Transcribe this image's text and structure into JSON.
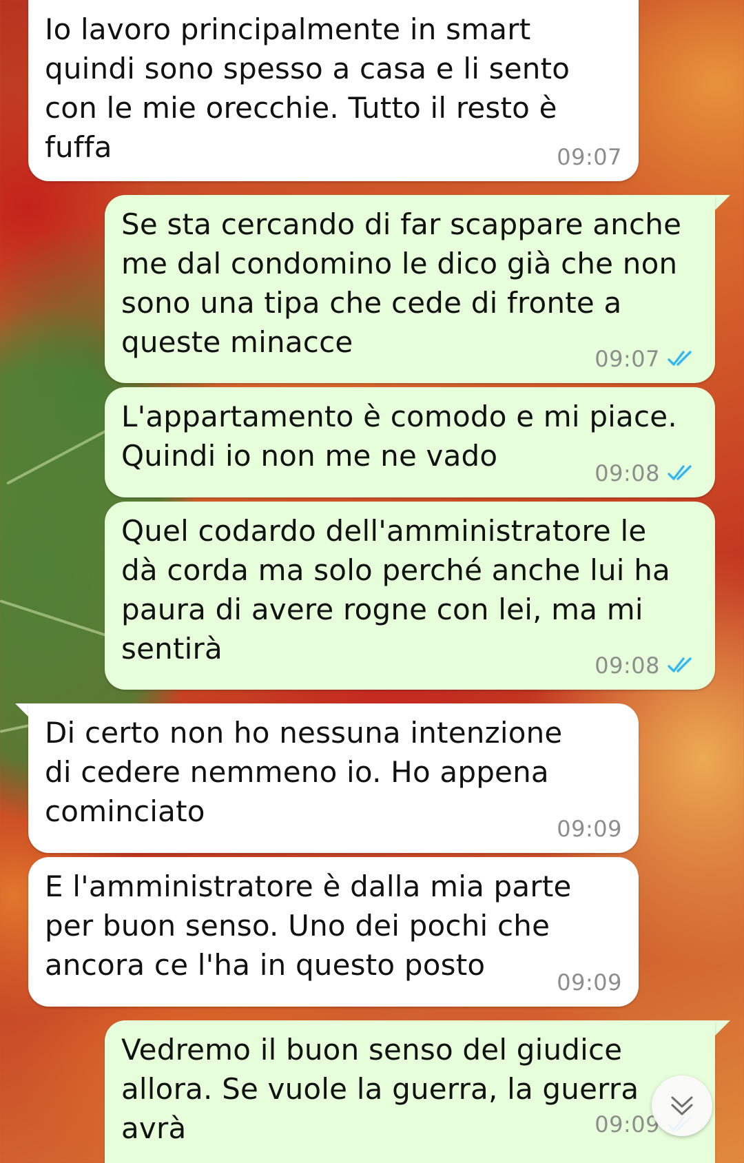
{
  "messages": [
    {
      "direction": "incoming",
      "text": "Io lavoro principalmente in smart\nquindi sono spesso a casa e li sento\ncon le mie orecchie. Tutto il resto è\nfuffa",
      "time": "09:07"
    },
    {
      "direction": "outgoing",
      "text": "Se sta cercando di far scappare anche\nme dal condomino le dico già che non\nsono una tipa che cede di fronte a\nqueste minacce",
      "time": "09:07",
      "status": "read"
    },
    {
      "direction": "outgoing",
      "text": "L'appartamento è comodo e mi piace.\nQuindi io non me ne vado",
      "time": "09:08",
      "status": "read"
    },
    {
      "direction": "outgoing",
      "text": "Quel codardo dell'amministratore le\ndà corda ma solo perché anche lui ha\npaura di avere rogne con lei, ma mi\nsentirà",
      "time": "09:08",
      "status": "read"
    },
    {
      "direction": "incoming",
      "text": "Di certo non ho nessuna intenzione\ndi cedere nemmeno io. Ho appena\ncominciato",
      "time": "09:09"
    },
    {
      "direction": "incoming",
      "text": "E l'amministratore è dalla mia parte\nper buon senso. Uno dei pochi che\nancora ce l'ha in questo posto",
      "time": "09:09"
    },
    {
      "direction": "outgoing",
      "text": "Vedremo il buon senso del giudice\nallora. Se vuole la guerra, la guerra\navrà",
      "time": "09:09",
      "status": "read"
    }
  ],
  "icons": {
    "read_receipt": "double-check-icon",
    "scroll_down": "chevron-double-down-icon"
  },
  "colors": {
    "incoming_bubble": "#ffffff",
    "outgoing_bubble": "#e6ffda",
    "read_tick": "#34b7f1",
    "timestamp": "#8d8d8d"
  }
}
